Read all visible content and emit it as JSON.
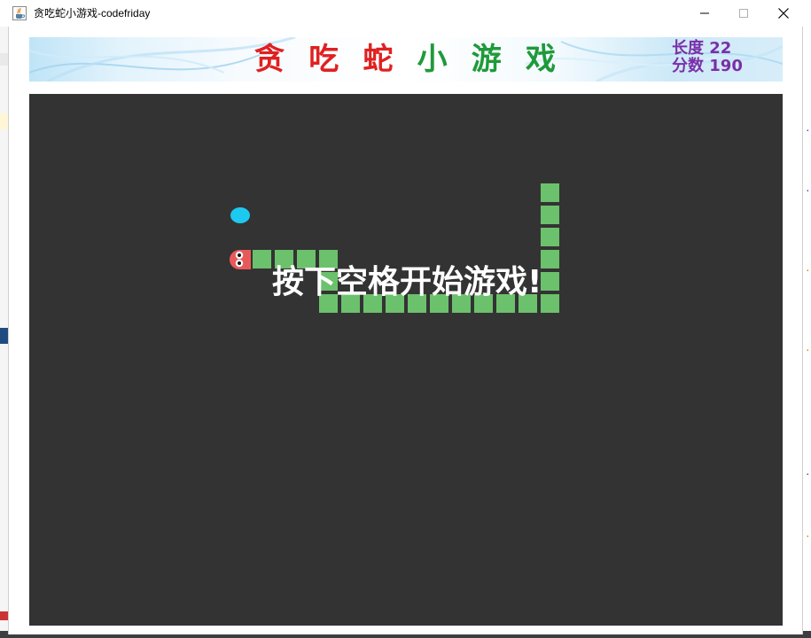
{
  "window": {
    "title": "贪吃蛇小游戏-codefriday"
  },
  "header": {
    "title_chars": [
      {
        "char": "贪",
        "color": "#e02020"
      },
      {
        "char": "吃",
        "color": "#e02020"
      },
      {
        "char": "蛇",
        "color": "#e02020"
      },
      {
        "char": "小",
        "color": "#1f9a3a"
      },
      {
        "char": "游",
        "color": "#1f9a3a"
      },
      {
        "char": "戏",
        "color": "#1f9a3a"
      }
    ],
    "length_text": "长度 22",
    "score_text": "分数 190"
  },
  "game": {
    "prompt": "按下空格开始游戏!",
    "cell_size": 25,
    "head": {
      "col": 9,
      "row": 7,
      "direction": "left",
      "color": "#e85a5a"
    },
    "body": [
      [
        10,
        7
      ],
      [
        11,
        7
      ],
      [
        12,
        7
      ],
      [
        13,
        7
      ],
      [
        13,
        8
      ],
      [
        13,
        9
      ],
      [
        14,
        9
      ],
      [
        15,
        9
      ],
      [
        16,
        9
      ],
      [
        17,
        9
      ],
      [
        18,
        9
      ],
      [
        19,
        9
      ],
      [
        20,
        9
      ],
      [
        21,
        9
      ],
      [
        22,
        9
      ],
      [
        23,
        9
      ],
      [
        23,
        8
      ],
      [
        23,
        7
      ],
      [
        23,
        6
      ],
      [
        23,
        5
      ],
      [
        23,
        4
      ]
    ],
    "food": {
      "col": 9,
      "row": 5
    },
    "colors": {
      "board": "#333333",
      "body": "#6cc16c",
      "food": "#1ec9f0",
      "text": "#ffffff",
      "stats": "#7a2fa8"
    }
  },
  "icons": {
    "app": "java-cup-icon",
    "minimize": "minimize-icon",
    "maximize": "maximize-icon",
    "close": "close-icon"
  }
}
